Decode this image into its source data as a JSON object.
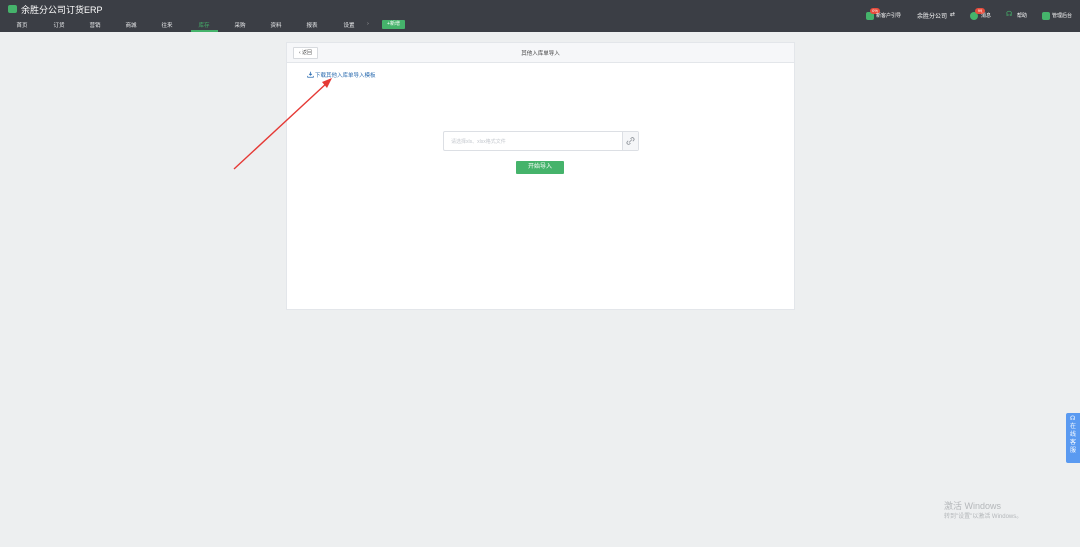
{
  "app": {
    "title": "余胜分公司订货ERP"
  },
  "nav": {
    "items": [
      {
        "label": "首页"
      },
      {
        "label": "订货"
      },
      {
        "label": "营销"
      },
      {
        "label": "商城"
      },
      {
        "label": "往来"
      },
      {
        "label": "库存"
      },
      {
        "label": "采购"
      },
      {
        "label": "资料"
      },
      {
        "label": "报表"
      },
      {
        "label": "设置"
      }
    ],
    "active": "库存",
    "more": "›",
    "add_label": "+新增"
  },
  "header_right": {
    "customer_guide": {
      "label": "新客户引导",
      "badge": "0%"
    },
    "company": {
      "label": "余胜分公司",
      "icon": "swap-icon"
    },
    "messages": {
      "label": "消息",
      "badge": "99"
    },
    "help": {
      "label": "帮助"
    },
    "admin": {
      "label": "管理后台"
    }
  },
  "panel": {
    "back_label": "‹ 返回",
    "title": "其他入库单导入",
    "download_link": "下载其他入库单导入模板",
    "file_placeholder": "请选择xls、xlsx格式文件",
    "start_label": "开始导入"
  },
  "side_tab": {
    "label": "在线客服"
  },
  "watermark": {
    "line1": "激活 Windows",
    "line2": "转到\"设置\"以激活 Windows。"
  },
  "colors": {
    "topbar": "#3b3e45",
    "accent": "#45b36b",
    "link": "#2b6cb0",
    "arrow": "#e53935",
    "side_tab": "#5a9af1"
  }
}
